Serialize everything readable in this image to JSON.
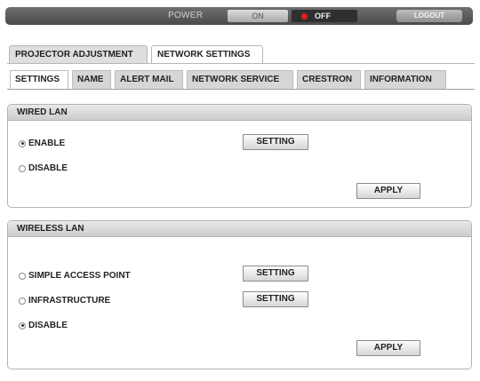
{
  "topbar": {
    "power_label": "POWER",
    "on_label": "ON",
    "off_label": "OFF",
    "logout_label": "LOGOUT"
  },
  "main_tabs": [
    {
      "label": "PROJECTOR ADJUSTMENT",
      "active": false
    },
    {
      "label": "NETWORK SETTINGS",
      "active": true
    }
  ],
  "sub_tabs": [
    {
      "label": "SETTINGS",
      "active": true
    },
    {
      "label": "NAME",
      "active": false
    },
    {
      "label": "ALERT MAIL",
      "active": false
    },
    {
      "label": "NETWORK SERVICE",
      "active": false
    },
    {
      "label": "CRESTRON",
      "active": false
    },
    {
      "label": "INFORMATION",
      "active": false
    }
  ],
  "wired_lan": {
    "title": "WIRED LAN",
    "options": [
      {
        "label": "ENABLE",
        "checked": true
      },
      {
        "label": "DISABLE",
        "checked": false
      }
    ],
    "setting_label": "SETTING",
    "apply_label": "APPLY"
  },
  "wireless_lan": {
    "title": "WIRELESS LAN",
    "options": [
      {
        "label": "SIMPLE ACCESS POINT",
        "checked": false
      },
      {
        "label": "INFRASTRUCTURE",
        "checked": false
      },
      {
        "label": "DISABLE",
        "checked": true
      }
    ],
    "setting_label": "SETTING",
    "apply_label": "APPLY"
  },
  "colors": {
    "power_off_indicator": "#e51c1c",
    "topbar": "#4a4a4a"
  }
}
